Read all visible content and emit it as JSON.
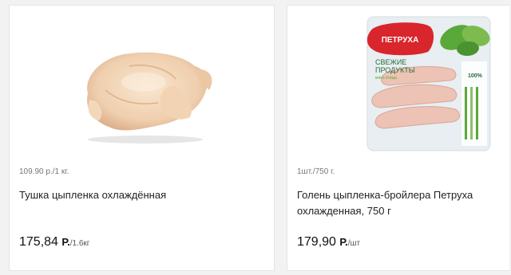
{
  "products": [
    {
      "unit_note": "109.90 р./1 кг.",
      "title": "Тушка цыпленка охлаждённая",
      "price": "175,84",
      "currency": "Р.",
      "per": "/1.6кг",
      "image": "raw-chicken-icon"
    },
    {
      "unit_note": "1шт./750 г.",
      "title": "Голень цыпленка-бройлера Петруха охлажденная, 750 г",
      "price": "179,90",
      "currency": "Р.",
      "per": "/шт",
      "image": "package-drumsticks-icon",
      "package": {
        "brand": "ПЕТРУХА",
        "line1": "СВЕЖИЕ",
        "line2": "ПРОДУКТЫ",
        "line3": "мясо птицы",
        "badge": "100%"
      }
    }
  ],
  "colors": {
    "brand_red": "#d9252c",
    "leaf_green": "#5aa83a",
    "tray": "#e8eef1"
  }
}
